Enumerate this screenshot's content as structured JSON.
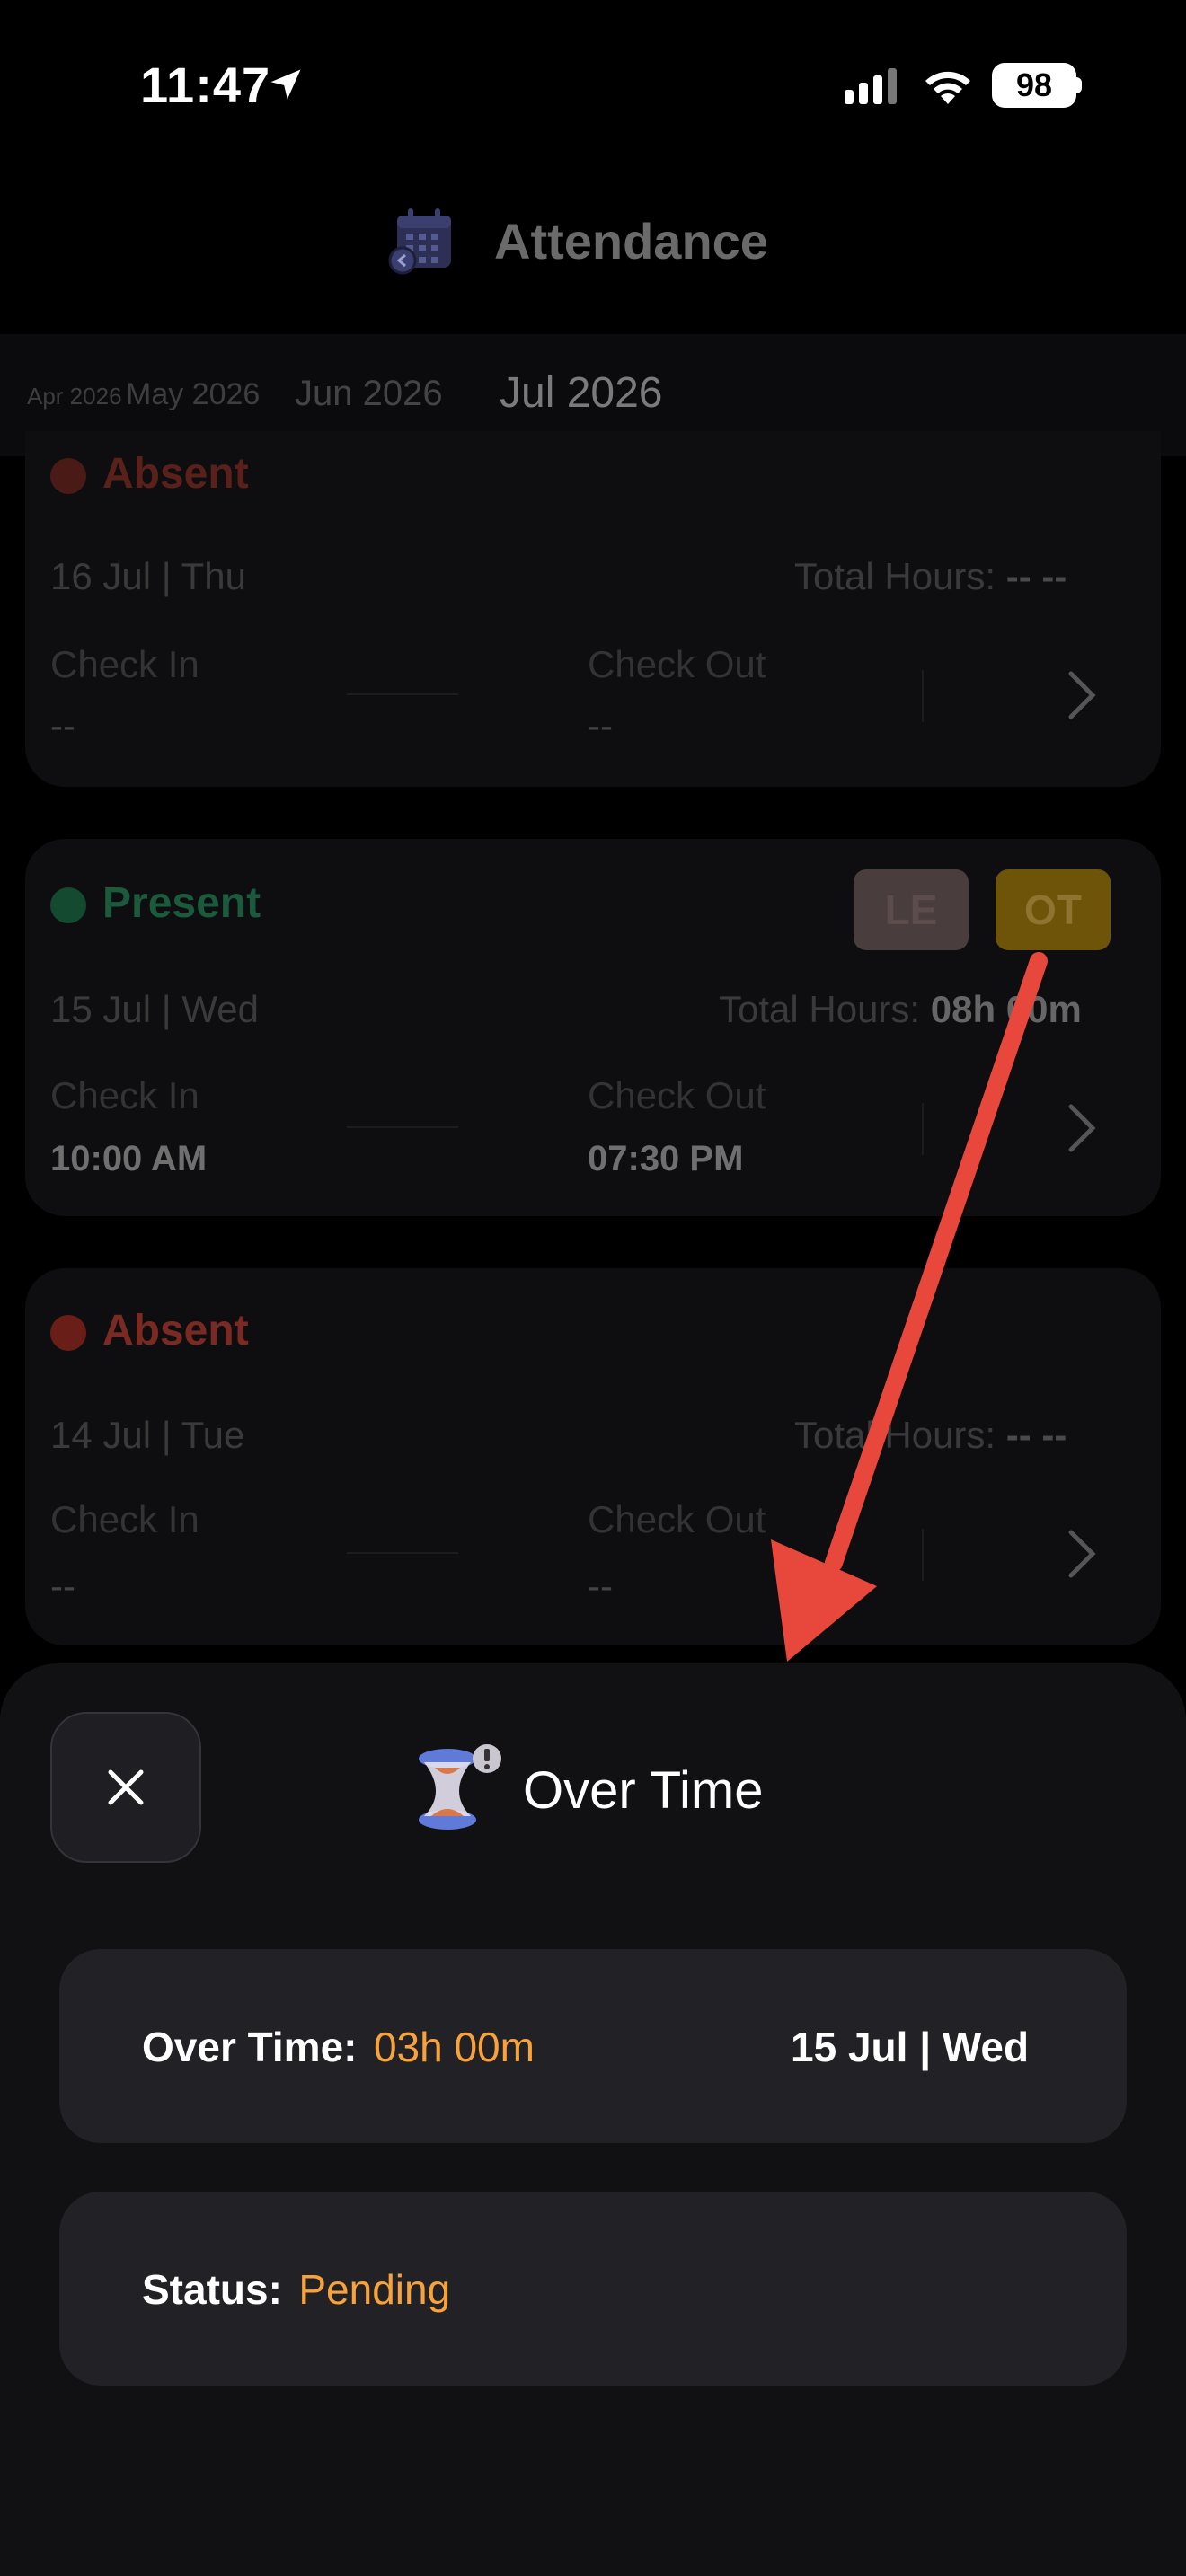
{
  "status_bar": {
    "time": "11:47",
    "battery": "98"
  },
  "header": {
    "title": "Attendance",
    "icon": "calendar-icon"
  },
  "months": [
    "Apr 2026",
    "May 2026",
    "Jun 2026",
    "Jul 2026"
  ],
  "cards": [
    {
      "status": "Absent",
      "date": "16 Jul | Thu",
      "hours_label": "Total Hours:",
      "hours": "-- --",
      "check_in_label": "Check In",
      "check_in": "--",
      "check_out_label": "Check Out",
      "check_out": "--"
    },
    {
      "status": "Present",
      "date": "15 Jul | Wed",
      "hours_label": "Total Hours:",
      "hours": "08h 00m",
      "check_in_label": "Check In",
      "check_in": "10:00 AM",
      "check_out_label": "Check Out",
      "check_out": "07:30 PM",
      "badges": [
        "LE",
        "OT"
      ]
    },
    {
      "status": "Absent",
      "date": "14 Jul | Tue",
      "hours_label": "Total Hours:",
      "hours": "-- --",
      "check_in_label": "Check In",
      "check_in": "--",
      "check_out_label": "Check Out",
      "check_out": "--"
    }
  ],
  "sheet": {
    "title": "Over Time",
    "icon": "hourglass-icon",
    "overtime_label": "Over Time:",
    "overtime_value": "03h 00m",
    "date": "15 Jul | Wed",
    "status_label": "Status:",
    "status_value": "Pending"
  },
  "colors": {
    "absent": "#7a2a22",
    "present": "#1f6b45",
    "accent_orange": "#f7a23b",
    "arrow": "#e8473c"
  }
}
